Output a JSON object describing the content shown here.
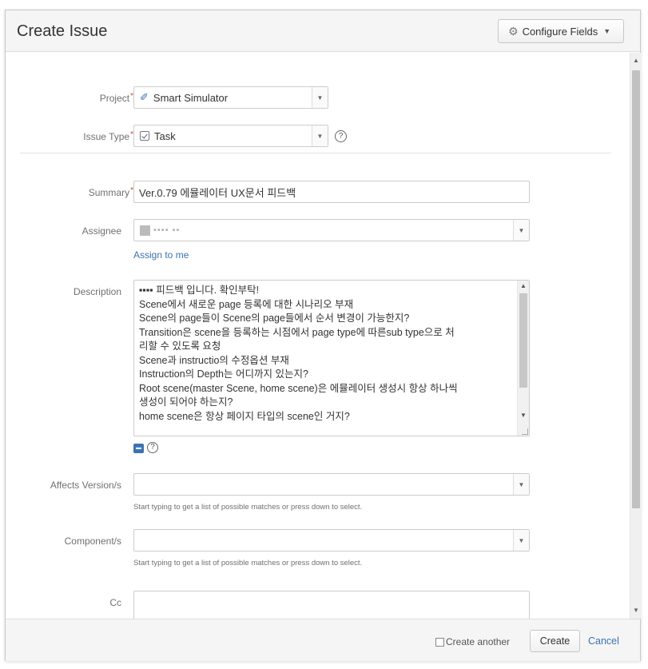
{
  "dialog": {
    "title": "Create Issue",
    "configure_fields_label": "Configure Fields",
    "configure_icon": "gear-icon"
  },
  "form": {
    "project": {
      "label": "Project",
      "required_marker": "*",
      "value": "Smart Simulator"
    },
    "issue_type": {
      "label": "Issue Type",
      "required_marker": "*",
      "value": "Task",
      "help": "?"
    },
    "summary": {
      "label": "Summary",
      "required_marker": "*",
      "value": "Ver.0.79 에뮬레이터 UX문서 피드백"
    },
    "assignee": {
      "label": "Assignee",
      "value": "▪▪▪▪ ▪▪",
      "assign_to_me": "Assign to me"
    },
    "description": {
      "label": "Description",
      "lines": [
        "▪▪▪▪ 피드백 입니다. 확인부탁!",
        "Scene에서 새로운 page 등록에 대한 시나리오 부재",
        "Scene의 page들이 Scene의 page들에서 순서 변경이 가능한지?",
        "Transition은 scene을 등록하는 시점에서 page type에 따른sub type으로 처",
        "리할 수 있도록 요청",
        "Scene과 instructio의 수정옵션 부재",
        "Instruction의 Depth는 어디까지 있는지?",
        "Root scene(master Scene, home scene)은 에뮬레이터 생성시 항상 하나씩",
        "생성이 되어야 하는지?",
        "home scene은 항상 페이지 타입의 scene인 거지?"
      ],
      "help": "?"
    },
    "affects_version": {
      "label": "Affects Version/s",
      "value": "",
      "hint": "Start typing to get a list of possible matches or press down to select."
    },
    "components": {
      "label": "Component/s",
      "value": "",
      "hint": "Start typing to get a list of possible matches or press down to select."
    },
    "cc": {
      "label": "Cc",
      "value": ""
    }
  },
  "footer": {
    "create_another_label": "Create another",
    "create_another_checked": false,
    "create_label": "Create",
    "cancel_label": "Cancel"
  },
  "colors": {
    "link": "#3b73af",
    "required": "#d04437",
    "header_bg": "#f5f5f5"
  }
}
